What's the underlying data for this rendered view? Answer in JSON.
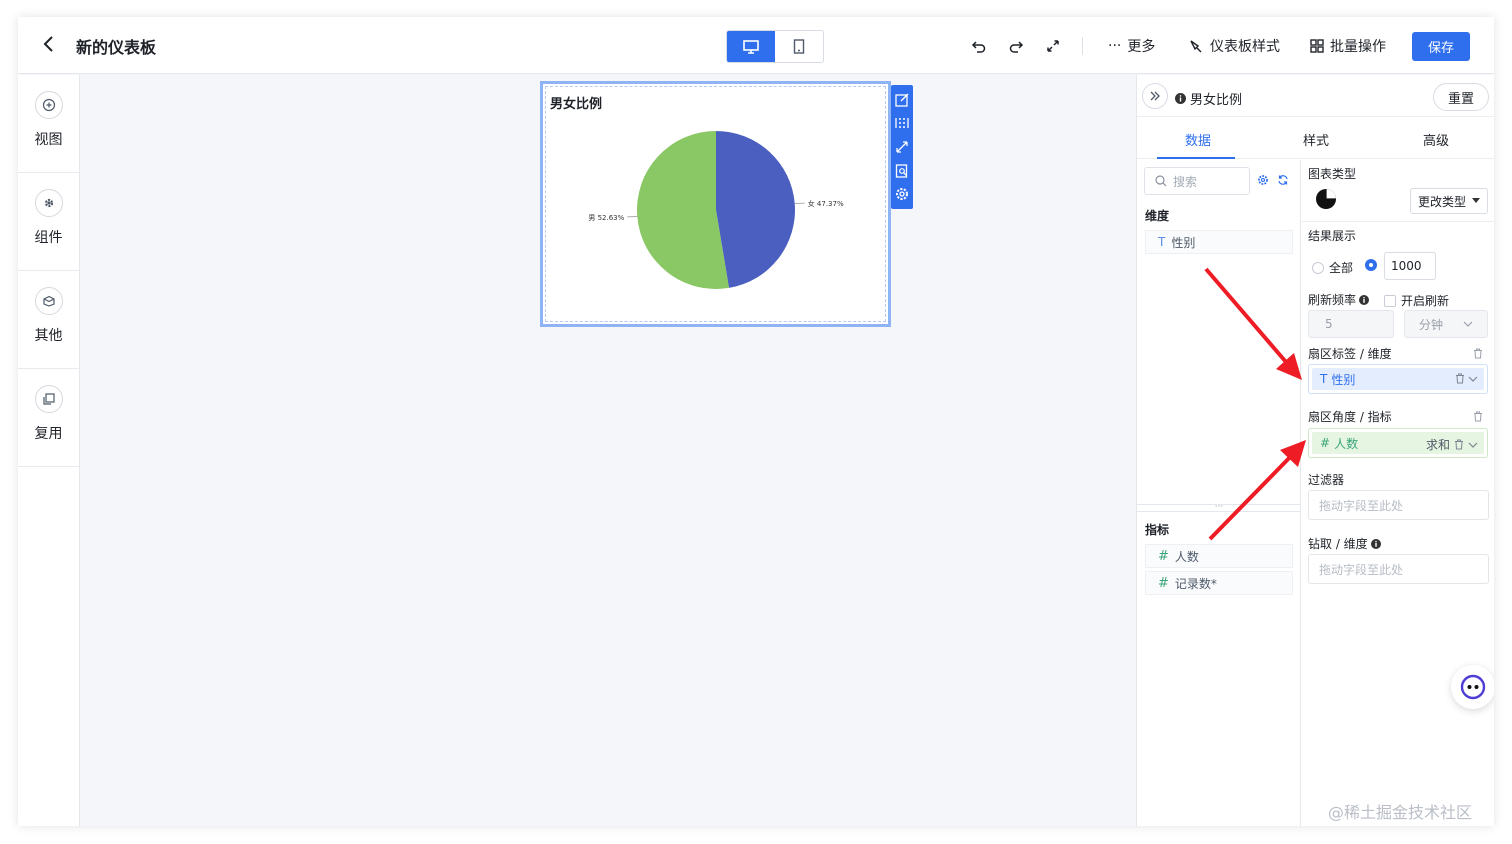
{
  "topbar": {
    "title": "新的仪表板",
    "more": "更多",
    "dashboard_style": "仪表板样式",
    "batch_ops": "批量操作",
    "save": "保存"
  },
  "sidebar": {
    "items": [
      {
        "label": "视图"
      },
      {
        "label": "组件"
      },
      {
        "label": "其他"
      },
      {
        "label": "复用"
      }
    ]
  },
  "widget": {
    "title": "男女比例"
  },
  "chart_data": {
    "type": "pie",
    "categories": [
      "女",
      "男"
    ],
    "values": [
      47.37,
      52.63
    ],
    "labels": [
      "女 47.37%",
      "男 52.63%"
    ],
    "colors": [
      "#4a5fbf",
      "#8ac765"
    ],
    "title": "男女比例"
  },
  "panel": {
    "title": "男女比例",
    "reset": "重置",
    "tabs": [
      "数据",
      "样式",
      "高级"
    ],
    "search_placeholder": "搜索",
    "dimensions_header": "维度",
    "dimensions": [
      "性别"
    ],
    "metrics_header": "指标",
    "metrics": [
      "人数",
      "记录数*"
    ],
    "chart_type_label": "图表类型",
    "change_type": "更改类型",
    "result_label": "结果展示",
    "result_all": "全部",
    "result_limit": "1000",
    "refresh_label": "刷新频率",
    "auto_refresh": "开启刷新",
    "refresh_value": "5",
    "refresh_unit": "分钟",
    "sector_label_title": "扇区标签 / 维度",
    "sector_label_field": "性别",
    "sector_angle_title": "扇区角度 / 指标",
    "sector_angle_field": "人数",
    "sector_angle_agg": "求和",
    "filter_label": "过滤器",
    "filter_placeholder": "拖动字段至此处",
    "drill_label": "钻取 / 维度",
    "drill_placeholder": "拖动字段至此处"
  },
  "watermark": "@稀土掘金技术社区",
  "colors": {
    "accent": "#2f6fed",
    "arrow": "#ee1c25"
  }
}
